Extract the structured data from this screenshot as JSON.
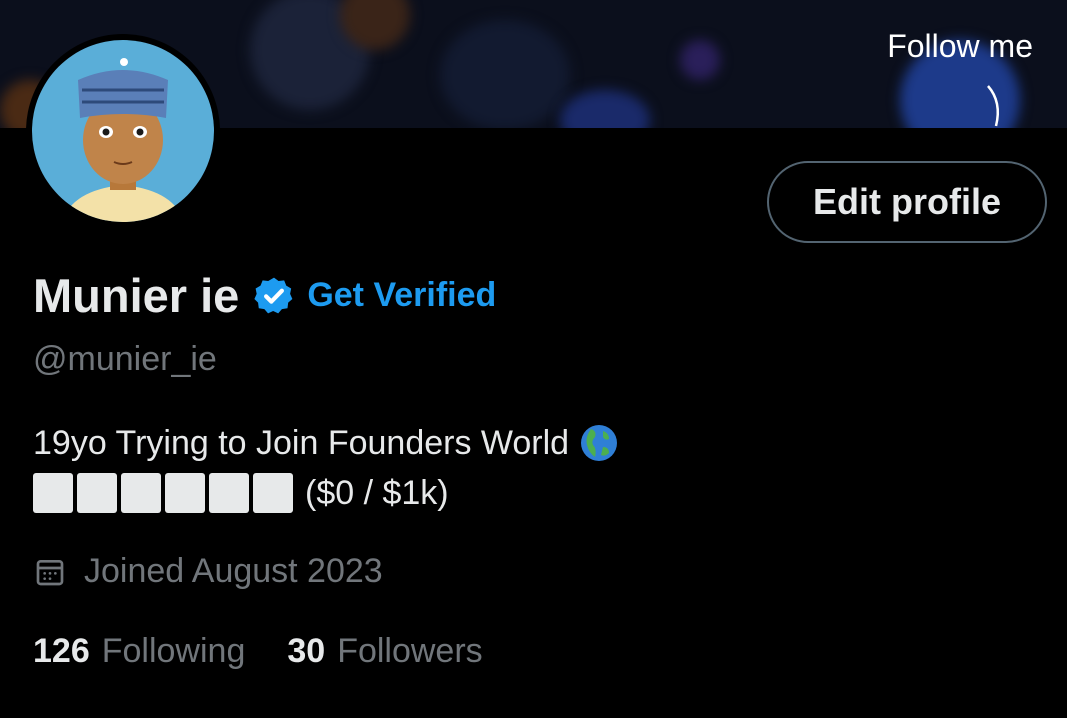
{
  "banner": {
    "note": "Follow me"
  },
  "profile": {
    "display_name": "Munier ie",
    "get_verified_label": "Get Verified",
    "handle": "@munier_ie",
    "bio_line1": "19yo Trying to Join Founders World",
    "bio_progress": "($0 / $1k)",
    "progress_blocks": 6,
    "joined": "Joined August 2023",
    "edit_profile_label": "Edit profile"
  },
  "stats": {
    "following_count": "126",
    "following_label": "Following",
    "followers_count": "30",
    "followers_label": "Followers"
  },
  "icons": {
    "verified": "verified-badge-icon",
    "globe": "globe-americas-icon",
    "calendar": "calendar-icon"
  },
  "colors": {
    "background": "#000000",
    "accent": "#1d9bf0",
    "primary_text": "#e7e9ea",
    "secondary_text": "#71767b",
    "button_border": "#536471"
  }
}
